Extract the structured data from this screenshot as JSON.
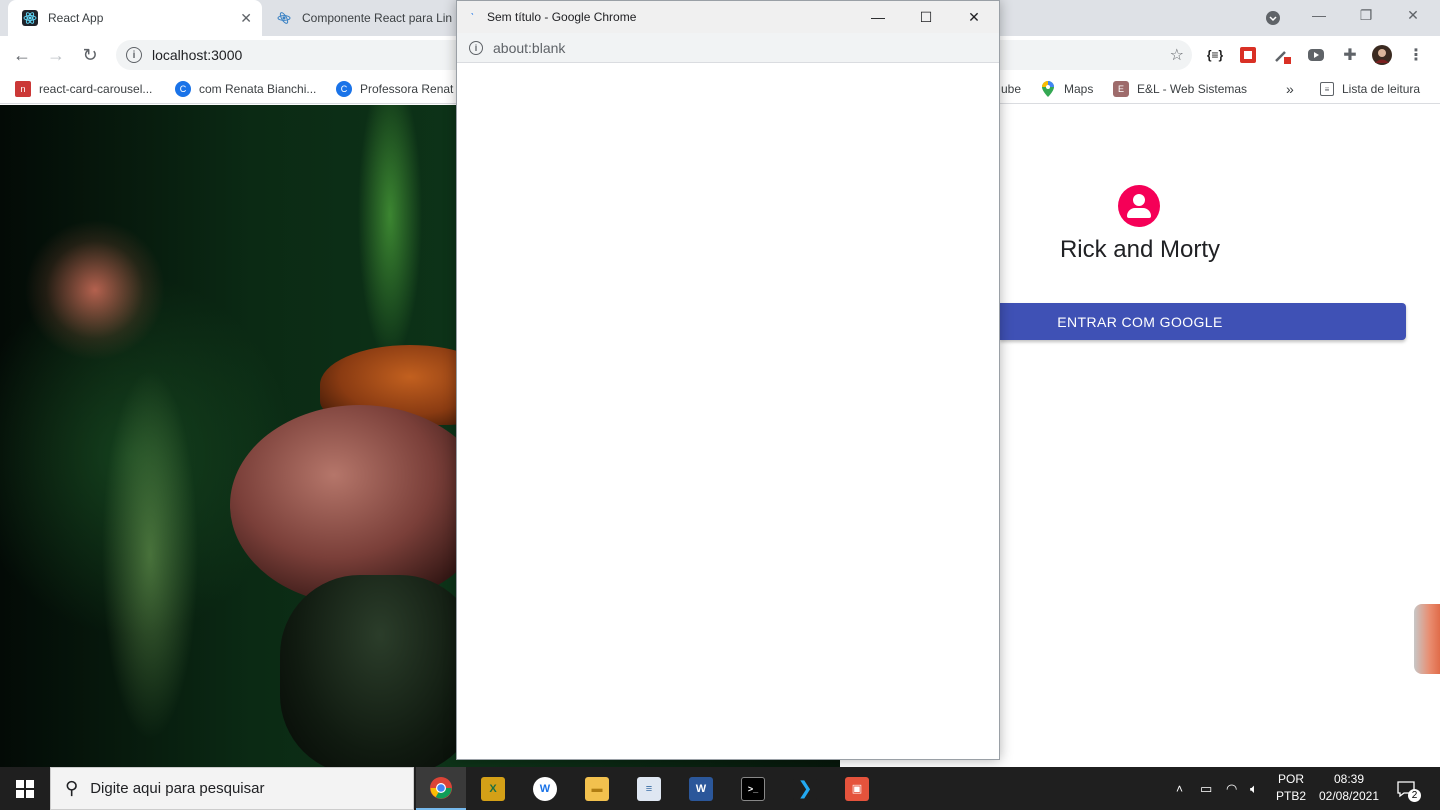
{
  "browser": {
    "tabs": [
      {
        "title": "React App",
        "favicon": "react-icon"
      },
      {
        "title": "Componente React para Lin",
        "favicon": "react-icon"
      }
    ],
    "url": "localhost:3000",
    "bookmarks": [
      {
        "label": "react-card-carousel...",
        "icon": "npm-icon"
      },
      {
        "label": "com Renata Bianchi...",
        "icon": "circle-c-icon"
      },
      {
        "label": "Professora Renat",
        "icon": "circle-c-icon"
      },
      {
        "label": "ube",
        "icon": "youtube-icon"
      },
      {
        "label": "Maps",
        "icon": "maps-pin-icon"
      },
      {
        "label": "E&L - Web Sistemas",
        "icon": "site-icon"
      }
    ],
    "more_bookmarks": "»",
    "reading_list": "Lista de leitura"
  },
  "popup": {
    "title": "Sem título - Google Chrome",
    "url": "about:blank"
  },
  "login": {
    "title": "Rick and Morty",
    "google_button": "ENTRAR COM GOOGLE",
    "avatar_color": "#f50057",
    "button_color": "#3f51b5"
  },
  "taskbar": {
    "search_placeholder": "Digite aqui para pesquisar",
    "language": "POR",
    "keyboard": "PTB2",
    "time": "08:39",
    "date": "02/08/2021",
    "notifications": "2",
    "apps": [
      "chrome-icon",
      "excel-like-icon",
      "app-icon",
      "file-explorer-icon",
      "notepad-icon",
      "word-icon",
      "terminal-icon",
      "vscode-icon",
      "app-red-icon"
    ]
  }
}
